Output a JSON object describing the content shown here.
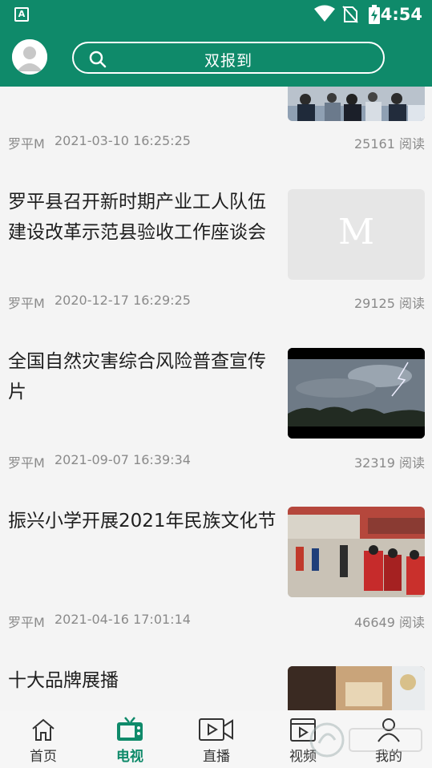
{
  "status_bar": {
    "time": "4:54",
    "app_icon_letter": "A"
  },
  "header": {
    "search_text": "双报到"
  },
  "feed": [
    {
      "title": "",
      "source": "罗平M",
      "datetime": "2021-03-10 16:25:25",
      "reads": "25161 阅读"
    },
    {
      "title": "罗平县召开新时期产业工人队伍建设改革示范县验收工作座谈会",
      "source": "罗平M",
      "datetime": "2020-12-17 16:29:25",
      "reads": "29125 阅读",
      "thumb_letter": "M"
    },
    {
      "title": "全国自然灾害综合风险普查宣传片",
      "source": "罗平M",
      "datetime": "2021-09-07 16:39:34",
      "reads": "32319 阅读"
    },
    {
      "title": "振兴小学开展2021年民族文化节",
      "source": "罗平M",
      "datetime": "2021-04-16 17:01:14",
      "reads": "46649 阅读"
    },
    {
      "title": "十大品牌展播"
    }
  ],
  "bottom_nav": [
    {
      "label": "首页",
      "icon": "home-icon"
    },
    {
      "label": "电视",
      "icon": "tv-icon",
      "active": true
    },
    {
      "label": "直播",
      "icon": "live-camera-icon"
    },
    {
      "label": "视频",
      "icon": "video-icon"
    },
    {
      "label": "我的",
      "icon": "profile-icon"
    }
  ],
  "colors": {
    "brand": "#0f8a6a",
    "background": "#f4f4f4",
    "meta": "#8a8a8a"
  }
}
